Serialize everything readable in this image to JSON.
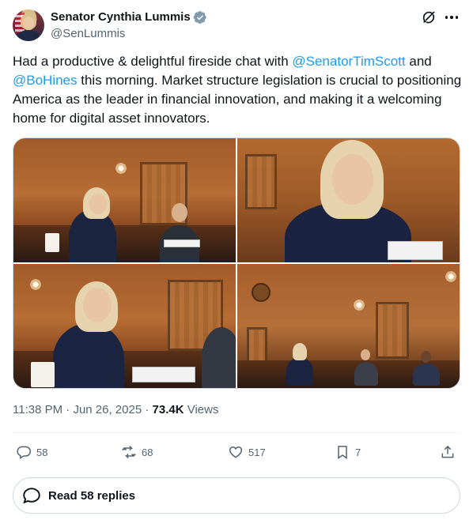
{
  "author": {
    "display_name": "Senator Cynthia Lummis",
    "handle": "@SenLummis"
  },
  "tweet": {
    "text_before_1": "Had a productive & delightful fireside chat with ",
    "mention_1": "@SenatorTimScott",
    "text_between": " and ",
    "mention_2": "@BoHines",
    "text_after": " this morning. Market structure legislation is crucial to positioning America as the leader in financial innovation, and making it a welcoming home for digital asset innovators."
  },
  "meta": {
    "time": "11:38 PM",
    "separator_1": " · ",
    "date": "Jun 26, 2025",
    "separator_2": " · ",
    "views_count": "73.4K",
    "views_label": " Views"
  },
  "actions": {
    "replies": "58",
    "reposts": "68",
    "likes": "517",
    "bookmarks": "7"
  },
  "read_replies_label": "Read 58 replies",
  "colors": {
    "accent": "#1d9bf0",
    "text": "#0f1419",
    "secondary": "#536471",
    "border": "#cfd9de",
    "verified_badge": "#829aab"
  },
  "icons": {
    "verified": "verified-badge-icon",
    "grok": "grok-icon",
    "more": "more-icon",
    "reply": "reply-icon",
    "repost": "repost-icon",
    "like": "heart-icon",
    "bookmark": "bookmark-icon",
    "share": "share-icon",
    "replies": "speech-bubble-icon"
  }
}
